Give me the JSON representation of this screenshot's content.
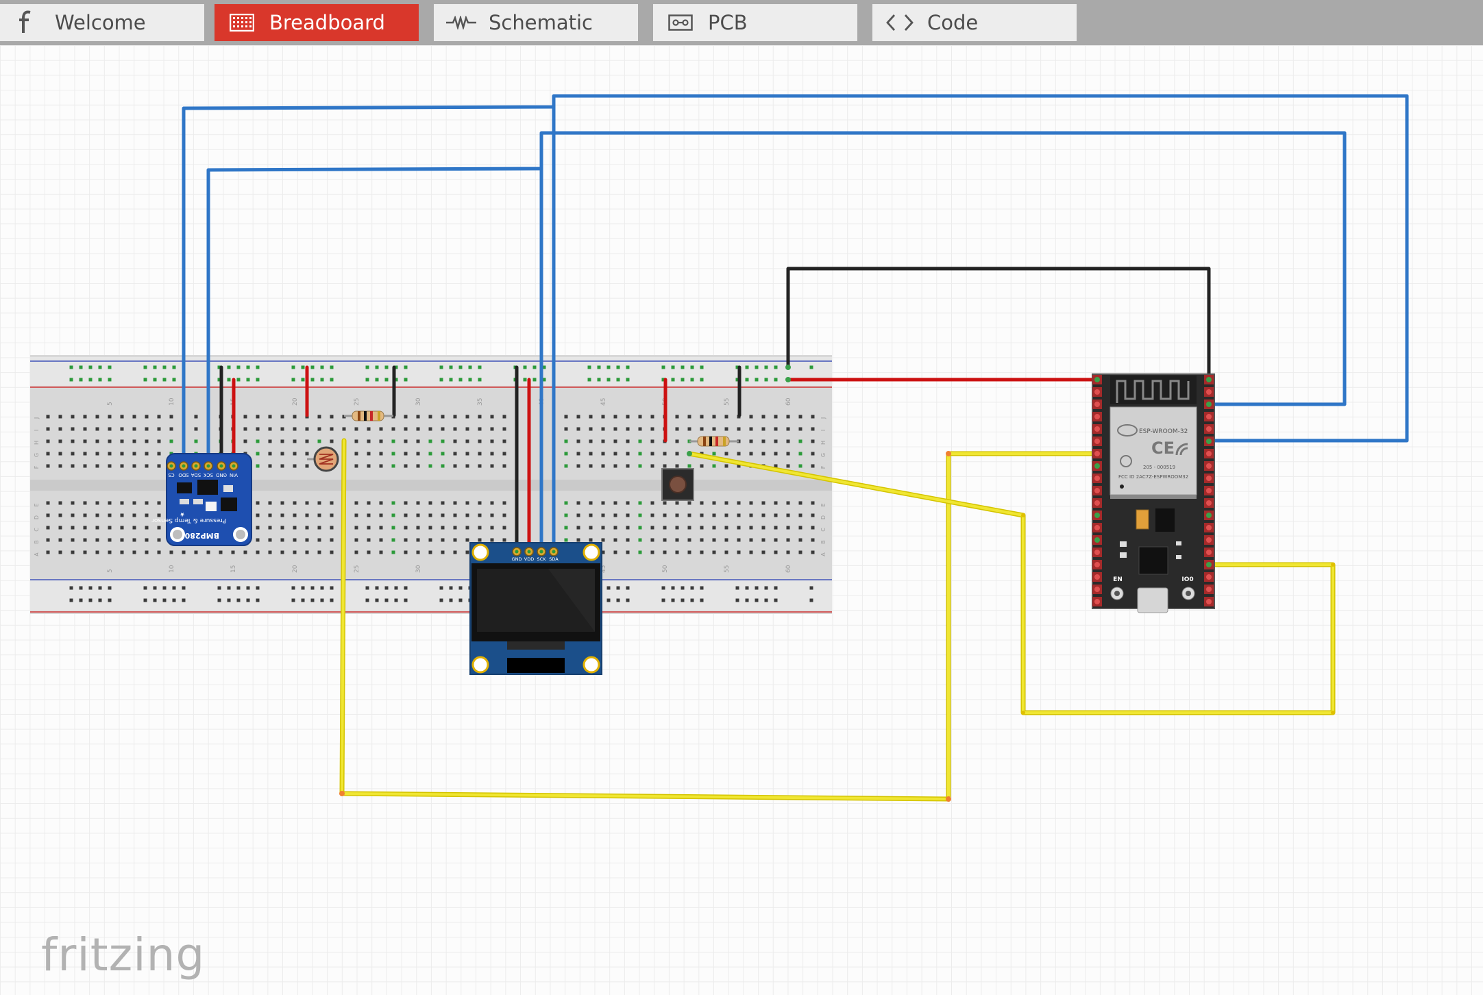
{
  "tabs": [
    {
      "label": "Welcome",
      "icon": "fritzing-logo-icon",
      "active": false
    },
    {
      "label": "Breadboard",
      "icon": "breadboard-icon",
      "active": true
    },
    {
      "label": "Schematic",
      "icon": "schematic-icon",
      "active": false
    },
    {
      "label": "PCB",
      "icon": "pcb-icon",
      "active": false
    },
    {
      "label": "Code",
      "icon": "code-icon",
      "active": false
    }
  ],
  "colors": {
    "tab_bar": "#a9a9a9",
    "tab_active": "#d9372b",
    "tab_inactive": "#ededed",
    "wire_blue": "#2f76c7",
    "wire_red": "#cc1111",
    "wire_black": "#222222",
    "wire_yellow": "#f0e632",
    "breakout_board": "#1e4fb0",
    "esp32_board": "#2a2a2a"
  },
  "bmp280": {
    "pins": [
      "CS",
      "SDO",
      "SDA",
      "SCK",
      "GND",
      "VIN"
    ],
    "name": "BMP280",
    "subtitle": "Pressure & Temp Sensor"
  },
  "oled": {
    "pins": [
      "GND",
      "VDD",
      "SCK",
      "SDA"
    ]
  },
  "esp32": {
    "module": "ESP-WROOM-32",
    "marks": "CE",
    "cert_line1": "205 - 000519",
    "cert_line2": "FCC ID 2AC7Z-ESPWROOM32",
    "button_left": "EN",
    "button_right": "IO0"
  },
  "breadboard": {
    "column_numbers": [
      "5",
      "10",
      "15",
      "20",
      "25",
      "30",
      "35",
      "40",
      "45",
      "50",
      "55",
      "60"
    ],
    "row_letters_top": [
      "J",
      "I",
      "H",
      "G",
      "F"
    ],
    "row_letters_bottom": [
      "E",
      "D",
      "C",
      "B",
      "A"
    ]
  },
  "brand": "fritzing"
}
